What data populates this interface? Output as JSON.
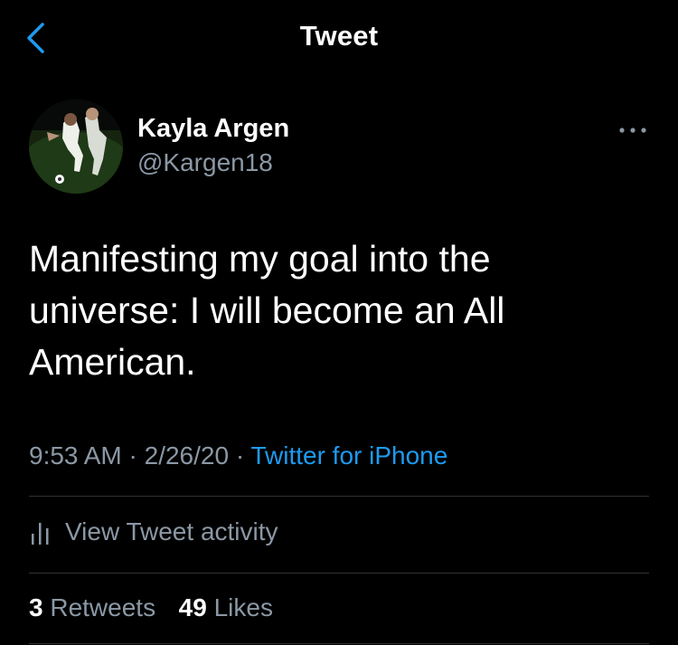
{
  "header": {
    "title": "Tweet",
    "back_icon": "chevron-left-icon"
  },
  "author": {
    "name": "Kayla Argen",
    "handle": "@Kargen18"
  },
  "tweet": {
    "text": "Manifesting my goal into the universe: I will become an All American.",
    "time": "9:53 AM",
    "date": "2/26/20",
    "separator": "·",
    "source": "Twitter for iPhone"
  },
  "activity": {
    "label": "View Tweet activity",
    "icon": "bar-chart-icon"
  },
  "stats": {
    "retweets_count": "3",
    "retweets_label": "Retweets",
    "likes_count": "49",
    "likes_label": "Likes"
  },
  "colors": {
    "background": "#000000",
    "accent": "#1d9bf0",
    "secondary_text": "#8b98a5",
    "divider": "#2f3336"
  }
}
